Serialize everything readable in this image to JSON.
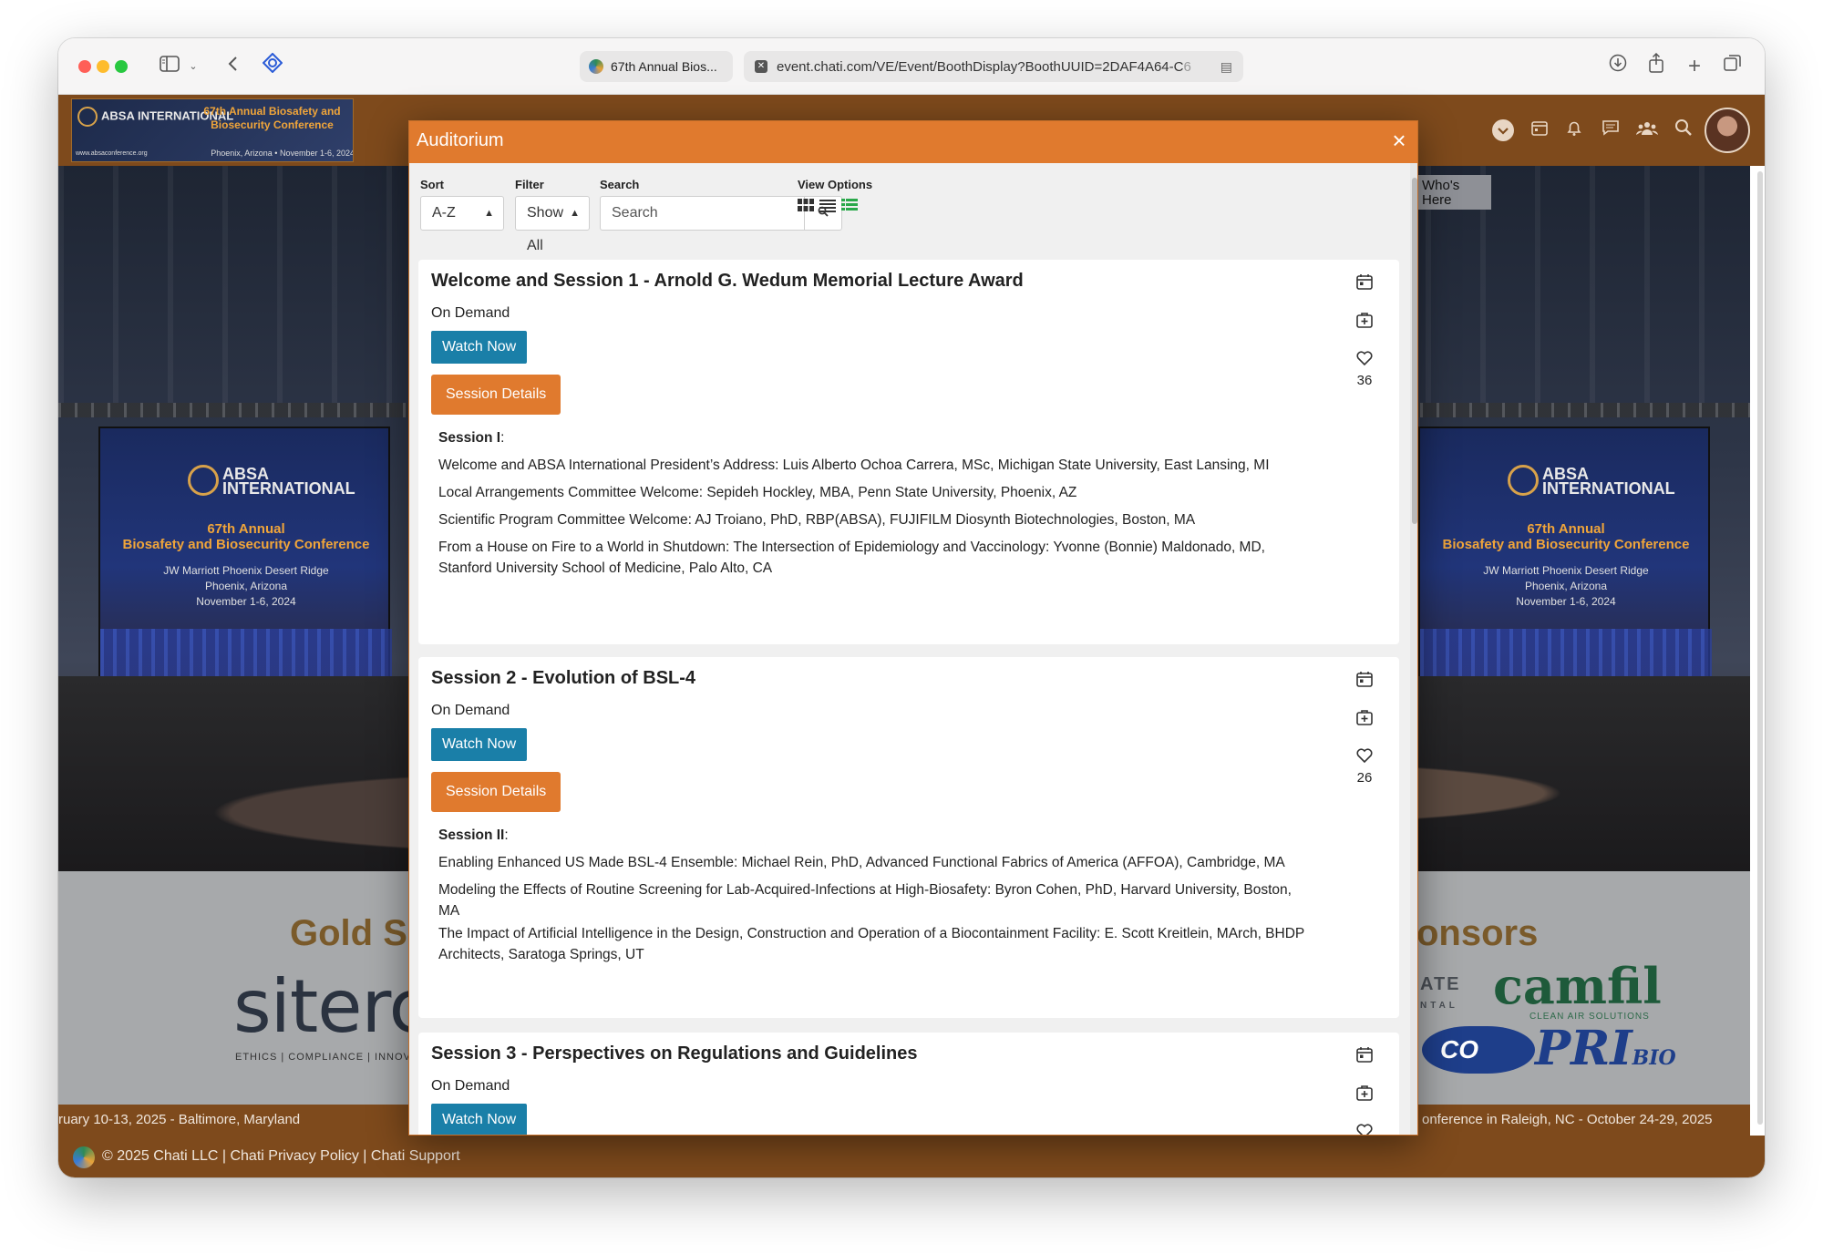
{
  "browser": {
    "tab_title": "67th Annual Bios...",
    "url_main": "event.chati.com/VE/Event/BoothDisplay?BoothUUID=2DAF4A64-C",
    "url_fade": "6"
  },
  "header": {
    "logo": {
      "org": "ABSA INTERNATIONAL",
      "conference": "67th Annual Biosafety and Biosecurity Conference",
      "location": "Phoenix, Arizona • November 1-6, 2024",
      "url": "www.absaconference.org"
    },
    "whos_here": "Who's Here"
  },
  "stage_screen": {
    "org": "ABSA INTERNATIONAL",
    "title_line1": "67th Annual",
    "title_line2": "Biosafety and Biosecurity Conference",
    "venue": "JW Marriott Phoenix Desert Ridge",
    "city": "Phoenix, Arizona",
    "dates": "November 1-6, 2024"
  },
  "sponsors": {
    "left_title": "Gold Sp",
    "right_title": "onsors",
    "siterc": "siterc",
    "siterc_tagline": "ETHICS | COMPLIANCE | INNOVAT",
    "ate": "ATE",
    "ate_small": "NTAL",
    "camfil": "camfil",
    "camfil_tagline": "CLEAN AIR SOLUTIONS",
    "co": "CO",
    "pri": "PRI",
    "pri_bio": "BIO"
  },
  "info_strip": {
    "left": "ruary 10-13, 2025  - Baltimore, Maryland",
    "right": "onference in Raleigh, NC  - October 24-29, 2025"
  },
  "footer": {
    "text": "© 2025 Chati LLC | Chati Privacy Policy | Chati Support"
  },
  "modal": {
    "title": "Auditorium",
    "close_symbol": "×",
    "controls": {
      "sort_label": "Sort",
      "sort_value": "A-Z",
      "filter_label": "Filter",
      "filter_value": "Show All",
      "search_label": "Search",
      "search_placeholder": "Search",
      "view_label": "View Options"
    },
    "sessions": [
      {
        "title": "Welcome and Session 1 - Arnold G. Wedum Memorial Lecture Award",
        "status": "On Demand",
        "watch_label": "Watch Now",
        "details_label": "Session Details",
        "likes": "36",
        "heading": "Session I",
        "lines": [
          "Welcome and ABSA International President’s Address: Luis Alberto Ochoa Carrera, MSc, Michigan State University, East Lansing, MI",
          "Local Arrangements Committee Welcome: Sepideh Hockley, MBA, Penn State University, Phoenix, AZ",
          "Scientific Program Committee Welcome: AJ Troiano, PhD, RBP(ABSA), FUJIFILM Diosynth Biotechnologies, Boston, MA",
          "From a House on Fire to a World in Shutdown: The Intersection of Epidemiology and Vaccinology: Yvonne (Bonnie) Maldonado, MD, Stanford University School of Medicine, Palo Alto, CA"
        ]
      },
      {
        "title": "Session 2 - Evolution of BSL-4",
        "status": "On Demand",
        "watch_label": "Watch Now",
        "details_label": "Session Details",
        "likes": "26",
        "heading": "Session II",
        "lines": [
          "Enabling Enhanced US Made BSL-4 Ensemble: Michael Rein, PhD, Advanced Functional Fabrics of America (AFFOA), Cambridge, MA",
          "Modeling the Effects of Routine Screening for Lab-Acquired-Infections at High-Biosafety: Byron Cohen, PhD, Harvard University, Boston, MA",
          "The Impact of Artificial Intelligence in the Design, Construction and Operation of a Biocontainment Facility: E. Scott Kreitlein, MArch, BHDP Architects, Saratoga Springs, UT"
        ]
      },
      {
        "title": "Session 3 - Perspectives on Regulations and Guidelines",
        "status": "On Demand",
        "watch_label": "Watch Now"
      }
    ]
  }
}
